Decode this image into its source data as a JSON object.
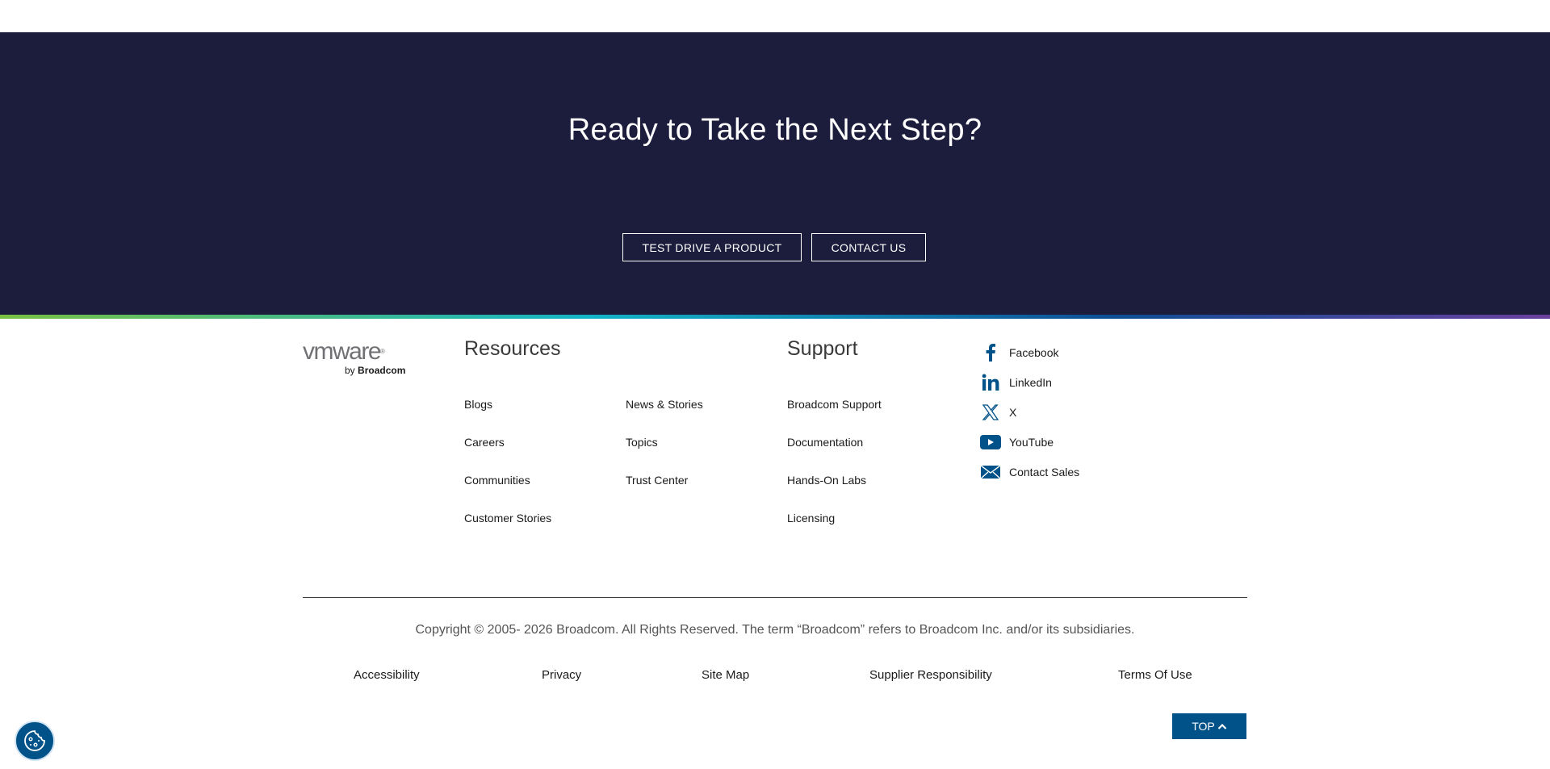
{
  "hero": {
    "title": "Ready to Take the Next Step?",
    "buttons": [
      "TEST DRIVE A PRODUCT",
      "CONTACT US"
    ]
  },
  "logo": {
    "name": "vmware",
    "reg": "®",
    "by": "by",
    "company": "Broadcom"
  },
  "resources": {
    "heading": "Resources",
    "col1": [
      "Blogs",
      "Careers",
      "Communities",
      "Customer Stories"
    ],
    "col2": [
      "News & Stories",
      "Topics",
      "Trust Center"
    ]
  },
  "support": {
    "heading": "Support",
    "links": [
      "Broadcom Support",
      "Documentation",
      "Hands-On Labs",
      "Licensing"
    ]
  },
  "social": [
    {
      "label": "Facebook",
      "icon": "facebook-icon"
    },
    {
      "label": "LinkedIn",
      "icon": "linkedin-icon"
    },
    {
      "label": "X",
      "icon": "x-icon"
    },
    {
      "label": "YouTube",
      "icon": "youtube-icon"
    },
    {
      "label": "Contact Sales",
      "icon": "mail-icon"
    }
  ],
  "copyright": "Copyright © 2005- 2026 Broadcom. All Rights Reserved. The term “Broadcom” refers to Broadcom Inc. and/or its subsidiaries.",
  "legal": [
    "Accessibility",
    "Privacy",
    "Site Map",
    "Supplier Responsibility",
    "Terms Of Use"
  ],
  "top_button": "TOP",
  "colors": {
    "hero_bg": "#1c1d3c",
    "accent_blue": "#005288",
    "gradient": [
      "#79c142",
      "#13b4c7",
      "#0d4e96",
      "#6a3f9e"
    ]
  }
}
